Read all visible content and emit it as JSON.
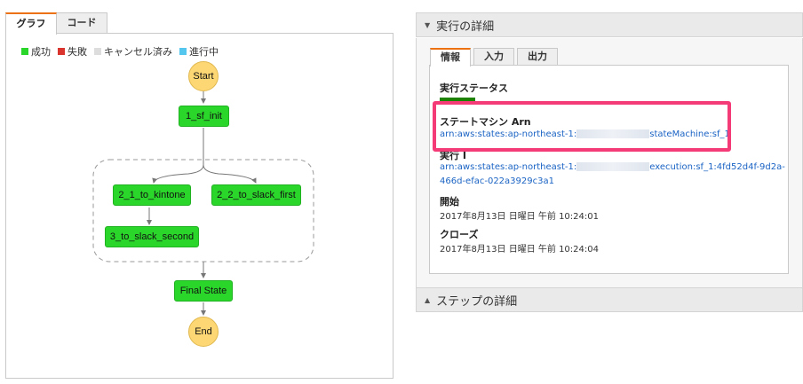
{
  "left_tabs": {
    "graph": "グラフ",
    "code": "コード"
  },
  "legend": [
    {
      "label": "成功",
      "color": "#2bd62b"
    },
    {
      "label": "失敗",
      "color": "#d9352e"
    },
    {
      "label": "キャンセル済み",
      "color": "#dddddd"
    },
    {
      "label": "進行中",
      "color": "#55c6ee"
    }
  ],
  "nodes": {
    "start": "Start",
    "init": "1_sf_init",
    "kintone": "2_1_to_kintone",
    "slack_first": "2_2_to_slack_first",
    "slack_second": "3_to_slack_second",
    "final": "Final State",
    "end": "End"
  },
  "execution_details": {
    "title": "実行の詳細",
    "tabs": {
      "info": "情報",
      "input": "入力",
      "output": "出力"
    },
    "status": {
      "label": "実行ステータス"
    },
    "state_machine": {
      "label": "ステートマシン Arn",
      "arn_prefix": "arn:aws:states:ap-northeast-1:",
      "arn_suffix": "stateMachine:sf_1"
    },
    "execution": {
      "label": "実行 I",
      "arn_prefix": "arn:aws:states:ap-northeast-1:",
      "arn_suffix": "execution:sf_1:4fd52d4f-9d2a-",
      "arn_line2": "466d-efac-022a3929c3a1"
    },
    "start": {
      "label": "開始",
      "value": "2017年8月13日 日曜日 午前 10:24:01"
    },
    "close": {
      "label": "クローズ",
      "value": "2017年8月13日 日曜日 午前 10:24:04"
    }
  },
  "step_details": {
    "title": "ステップの詳細"
  }
}
